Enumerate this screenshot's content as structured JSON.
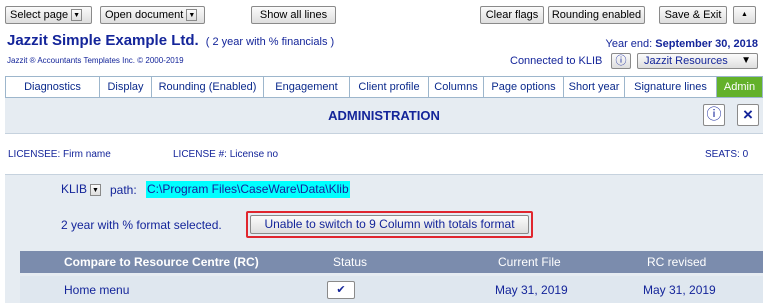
{
  "toolbar": {
    "select_page": "Select page",
    "open_document": "Open document",
    "show_all_lines": "Show all lines",
    "clear_flags": "Clear flags",
    "rounding": "Rounding enabled",
    "save_exit": "Save & Exit",
    "up_arrow": "▲"
  },
  "header": {
    "company": "Jazzit Simple Example Ltd.",
    "subtitle": "( 2 year with % financials )",
    "copyright": "Jazzit ® Accountants Templates Inc. © 2000-2019",
    "year_end_label": "Year end:",
    "year_end_value": "September 30, 2018",
    "connected": "Connected to KLIB",
    "info_glyph": "ⓘ",
    "resources": "Jazzit Resources"
  },
  "tabs": [
    {
      "label": "Diagnostics"
    },
    {
      "label": "Display"
    },
    {
      "label": "Rounding (Enabled)"
    },
    {
      "label": "Engagement"
    },
    {
      "label": "Client profile"
    },
    {
      "label": "Columns"
    },
    {
      "label": "Page options"
    },
    {
      "label": "Short year"
    },
    {
      "label": "Signature lines"
    },
    {
      "label": "Admin"
    }
  ],
  "admin": {
    "title": "ADMINISTRATION",
    "info_glyph": "ⓘ",
    "close_glyph": "×",
    "licensee": "LICENSEE: Firm name",
    "license_no": "LICENSE #:  License no",
    "seats": "SEATS: 0",
    "klib_label": "KLIB",
    "path_label": "path:",
    "path_value": "C:\\Program Files\\CaseWare\\Data\\Klib",
    "format_selected": "2 year with % format selected.",
    "switch_button": "Unable to switch to 9 Column with totals format"
  },
  "table": {
    "headers": [
      "Compare to Resource Centre (RC)",
      "Status",
      "Current File",
      "RC revised"
    ],
    "rows": [
      {
        "name": "Home menu",
        "status_glyph": "✔",
        "current": "May 31, 2019",
        "revised": "May 31, 2019"
      }
    ]
  },
  "colors": {
    "accent_blue": "#14259a",
    "active_tab": "#63b12a",
    "highlight": "#00ffff",
    "error_outline": "#e0262e"
  }
}
